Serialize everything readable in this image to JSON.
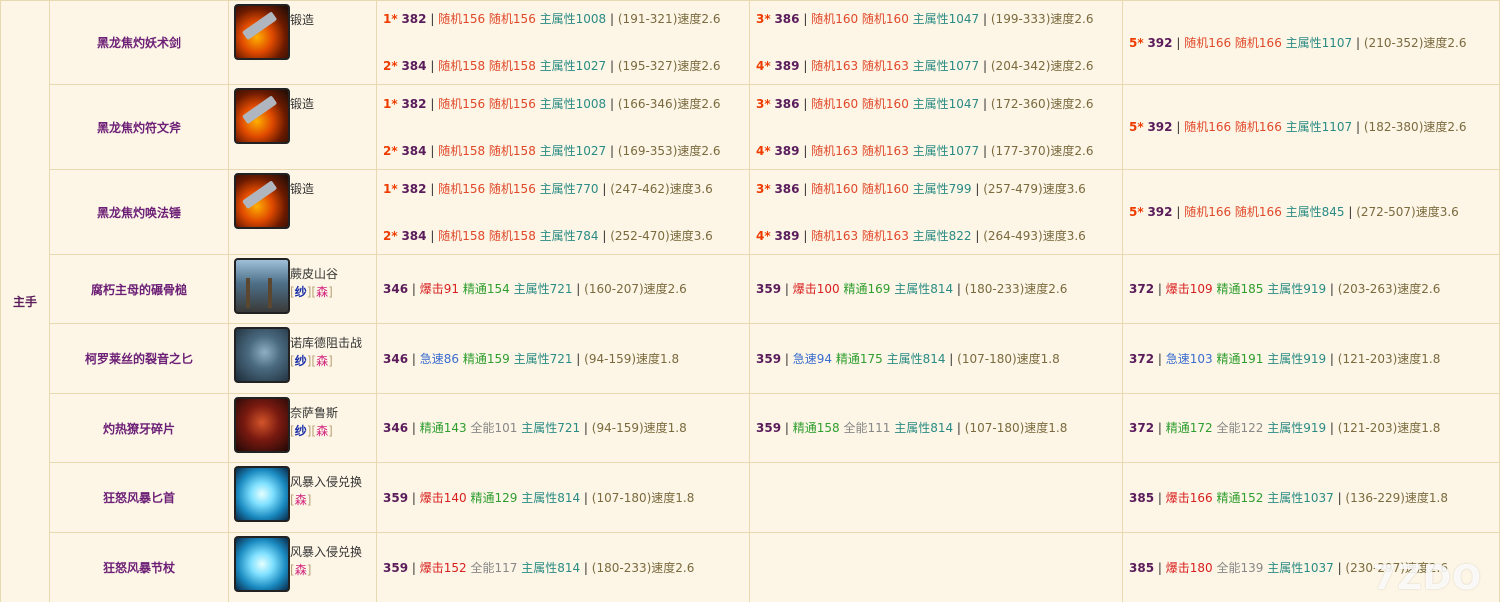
{
  "slot_label": "主手",
  "watermark": "7ZDO",
  "rows": [
    {
      "name": "黑龙焦灼妖术剑",
      "icon": "forge-flame-icon",
      "icon_class": "forge",
      "source": {
        "text": "锻造",
        "diffs": []
      },
      "height": 84,
      "crafted": true,
      "cells": [
        [
          {
            "star": "1*",
            "ilvl": "382",
            "parts": [
              [
                "rnd",
                "随机156"
              ],
              [
                "rnd",
                "随机156"
              ],
              [
                "main",
                "主属性1008"
              ]
            ],
            "dmg": "(191-321)速度2.6"
          },
          {
            "star": "2*",
            "ilvl": "384",
            "parts": [
              [
                "rnd",
                "随机158"
              ],
              [
                "rnd",
                "随机158"
              ],
              [
                "main",
                "主属性1027"
              ]
            ],
            "dmg": "(195-327)速度2.6"
          }
        ],
        [
          {
            "star": "3*",
            "ilvl": "386",
            "parts": [
              [
                "rnd",
                "随机160"
              ],
              [
                "rnd",
                "随机160"
              ],
              [
                "main",
                "主属性1047"
              ]
            ],
            "dmg": "(199-333)速度2.6"
          },
          {
            "star": "4*",
            "ilvl": "389",
            "parts": [
              [
                "rnd",
                "随机163"
              ],
              [
                "rnd",
                "随机163"
              ],
              [
                "main",
                "主属性1077"
              ]
            ],
            "dmg": "(204-342)速度2.6"
          }
        ],
        [
          {
            "star": "5*",
            "ilvl": "392",
            "parts": [
              [
                "rnd",
                "随机166"
              ],
              [
                "rnd",
                "随机166"
              ],
              [
                "main",
                "主属性1107"
              ]
            ],
            "dmg": "(210-352)速度2.6"
          }
        ]
      ]
    },
    {
      "name": "黑龙焦灼符文斧",
      "icon": "forge-flame-icon",
      "icon_class": "forge",
      "source": {
        "text": "锻造",
        "diffs": []
      },
      "height": 85,
      "crafted": true,
      "cells": [
        [
          {
            "star": "1*",
            "ilvl": "382",
            "parts": [
              [
                "rnd",
                "随机156"
              ],
              [
                "rnd",
                "随机156"
              ],
              [
                "main",
                "主属性1008"
              ]
            ],
            "dmg": "(166-346)速度2.6"
          },
          {
            "star": "2*",
            "ilvl": "384",
            "parts": [
              [
                "rnd",
                "随机158"
              ],
              [
                "rnd",
                "随机158"
              ],
              [
                "main",
                "主属性1027"
              ]
            ],
            "dmg": "(169-353)速度2.6"
          }
        ],
        [
          {
            "star": "3*",
            "ilvl": "386",
            "parts": [
              [
                "rnd",
                "随机160"
              ],
              [
                "rnd",
                "随机160"
              ],
              [
                "main",
                "主属性1047"
              ]
            ],
            "dmg": "(172-360)速度2.6"
          },
          {
            "star": "4*",
            "ilvl": "389",
            "parts": [
              [
                "rnd",
                "随机163"
              ],
              [
                "rnd",
                "随机163"
              ],
              [
                "main",
                "主属性1077"
              ]
            ],
            "dmg": "(177-370)速度2.6"
          }
        ],
        [
          {
            "star": "5*",
            "ilvl": "392",
            "parts": [
              [
                "rnd",
                "随机166"
              ],
              [
                "rnd",
                "随机166"
              ],
              [
                "main",
                "主属性1107"
              ]
            ],
            "dmg": "(182-380)速度2.6"
          }
        ]
      ]
    },
    {
      "name": "黑龙焦灼唤法锤",
      "icon": "forge-flame-icon",
      "icon_class": "forge",
      "source": {
        "text": "锻造",
        "diffs": []
      },
      "height": 85,
      "crafted": true,
      "cells": [
        [
          {
            "star": "1*",
            "ilvl": "382",
            "parts": [
              [
                "rnd",
                "随机156"
              ],
              [
                "rnd",
                "随机156"
              ],
              [
                "main",
                "主属性770"
              ]
            ],
            "dmg": "(247-462)速度3.6"
          },
          {
            "star": "2*",
            "ilvl": "384",
            "parts": [
              [
                "rnd",
                "随机158"
              ],
              [
                "rnd",
                "随机158"
              ],
              [
                "main",
                "主属性784"
              ]
            ],
            "dmg": "(252-470)速度3.6"
          }
        ],
        [
          {
            "star": "3*",
            "ilvl": "386",
            "parts": [
              [
                "rnd",
                "随机160"
              ],
              [
                "rnd",
                "随机160"
              ],
              [
                "main",
                "主属性799"
              ]
            ],
            "dmg": "(257-479)速度3.6"
          },
          {
            "star": "4*",
            "ilvl": "389",
            "parts": [
              [
                "rnd",
                "随机163"
              ],
              [
                "rnd",
                "随机163"
              ],
              [
                "main",
                "主属性822"
              ]
            ],
            "dmg": "(264-493)速度3.6"
          }
        ],
        [
          {
            "star": "5*",
            "ilvl": "392",
            "parts": [
              [
                "rnd",
                "随机166"
              ],
              [
                "rnd",
                "随机166"
              ],
              [
                "main",
                "主属性845"
              ]
            ],
            "dmg": "(272-507)速度3.6"
          }
        ]
      ]
    },
    {
      "name": "腐朽主母的碾骨槌",
      "icon": "valley-icon",
      "icon_class": "valley",
      "source": {
        "text": "蕨皮山谷",
        "diffs": [
          "m",
          "s"
        ]
      },
      "height": 69,
      "crafted": false,
      "cells": [
        [
          {
            "ilvl": "346",
            "parts": [
              [
                "crit",
                "爆击91"
              ],
              [
                "mast",
                "精通154"
              ],
              [
                "main",
                "主属性721"
              ]
            ],
            "dmg": "(160-207)速度2.6"
          }
        ],
        [
          {
            "ilvl": "359",
            "parts": [
              [
                "crit",
                "爆击100"
              ],
              [
                "mast",
                "精通169"
              ],
              [
                "main",
                "主属性814"
              ]
            ],
            "dmg": "(180-233)速度2.6"
          }
        ],
        [
          {
            "ilvl": "372",
            "parts": [
              [
                "crit",
                "爆击109"
              ],
              [
                "mast",
                "精通185"
              ],
              [
                "main",
                "主属性919"
              ]
            ],
            "dmg": "(203-263)速度2.6"
          }
        ]
      ]
    },
    {
      "name": "柯罗莱丝的裂音之匕",
      "icon": "beast-icon",
      "icon_class": "beast",
      "source": {
        "text": "诺库德阻击战",
        "diffs": [
          "m",
          "s"
        ]
      },
      "height": 70,
      "crafted": false,
      "cells": [
        [
          {
            "ilvl": "346",
            "parts": [
              [
                "haste",
                "急速86"
              ],
              [
                "mast",
                "精通159"
              ],
              [
                "main",
                "主属性721"
              ]
            ],
            "dmg": "(94-159)速度1.8"
          }
        ],
        [
          {
            "ilvl": "359",
            "parts": [
              [
                "haste",
                "急速94"
              ],
              [
                "mast",
                "精通175"
              ],
              [
                "main",
                "主属性814"
              ]
            ],
            "dmg": "(107-180)速度1.8"
          }
        ],
        [
          {
            "ilvl": "372",
            "parts": [
              [
                "haste",
                "急速103"
              ],
              [
                "mast",
                "精通191"
              ],
              [
                "main",
                "主属性919"
              ]
            ],
            "dmg": "(121-203)速度1.8"
          }
        ]
      ]
    },
    {
      "name": "灼热獠牙碎片",
      "icon": "demon-icon",
      "icon_class": "demon",
      "source": {
        "text": "奈萨鲁斯",
        "diffs": [
          "m",
          "s"
        ]
      },
      "height": 69,
      "crafted": false,
      "cells": [
        [
          {
            "ilvl": "346",
            "parts": [
              [
                "mast",
                "精通143"
              ],
              [
                "vers",
                "全能101"
              ],
              [
                "main",
                "主属性721"
              ]
            ],
            "dmg": "(94-159)速度1.8"
          }
        ],
        [
          {
            "ilvl": "359",
            "parts": [
              [
                "mast",
                "精通158"
              ],
              [
                "vers",
                "全能111"
              ],
              [
                "main",
                "主属性814"
              ]
            ],
            "dmg": "(107-180)速度1.8"
          }
        ],
        [
          {
            "ilvl": "372",
            "parts": [
              [
                "mast",
                "精通172"
              ],
              [
                "vers",
                "全能122"
              ],
              [
                "main",
                "主属性919"
              ]
            ],
            "dmg": "(121-203)速度1.8"
          }
        ]
      ]
    },
    {
      "name": "狂怒风暴匕首",
      "icon": "storm-icon",
      "icon_class": "storm",
      "source": {
        "text": "风暴入侵兑换",
        "diffs": [
          "s"
        ]
      },
      "height": 70,
      "crafted": false,
      "cells": [
        [
          {
            "ilvl": "359",
            "parts": [
              [
                "crit",
                "爆击140"
              ],
              [
                "mast",
                "精通129"
              ],
              [
                "main",
                "主属性814"
              ]
            ],
            "dmg": "(107-180)速度1.8"
          }
        ],
        [],
        [
          {
            "ilvl": "385",
            "parts": [
              [
                "crit",
                "爆击166"
              ],
              [
                "mast",
                "精通152"
              ],
              [
                "main",
                "主属性1037"
              ]
            ],
            "dmg": "(136-229)速度1.8"
          }
        ]
      ]
    },
    {
      "name": "狂怒风暴节杖",
      "icon": "storm-icon",
      "icon_class": "storm",
      "source": {
        "text": "风暴入侵兑换",
        "diffs": [
          "s"
        ]
      },
      "height": 70,
      "crafted": false,
      "cells": [
        [
          {
            "ilvl": "359",
            "parts": [
              [
                "crit",
                "爆击152"
              ],
              [
                "vers",
                "全能117"
              ],
              [
                "main",
                "主属性814"
              ]
            ],
            "dmg": "(180-233)速度2.6"
          }
        ],
        [],
        [
          {
            "ilvl": "385",
            "parts": [
              [
                "crit",
                "爆击180"
              ],
              [
                "vers",
                "全能139"
              ],
              [
                "main",
                "主属性1037"
              ]
            ],
            "dmg": "(230-297)速度2.6"
          }
        ]
      ]
    }
  ],
  "diff_labels": {
    "m": "纱",
    "s": "森"
  }
}
